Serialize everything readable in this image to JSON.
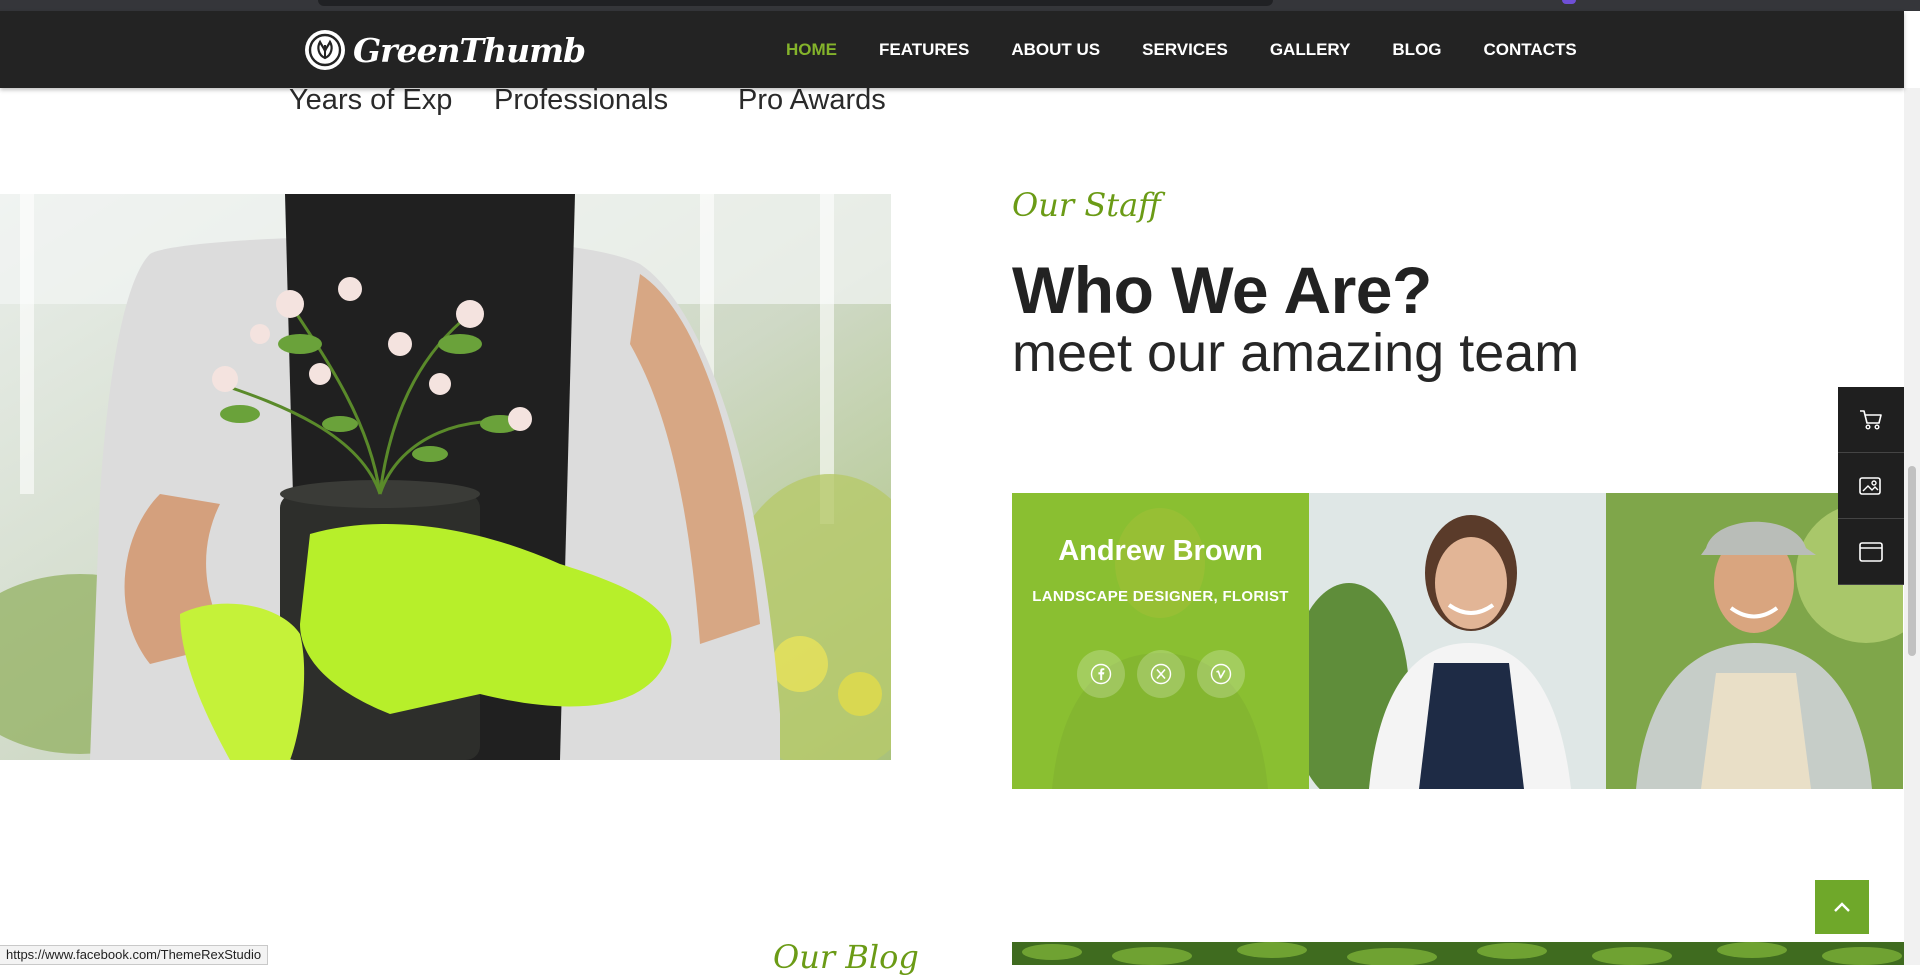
{
  "brand": {
    "name": "GreenThumb",
    "accent": "#84b32b"
  },
  "nav": {
    "items": [
      {
        "label": "HOME",
        "active": true
      },
      {
        "label": "FEATURES",
        "active": false
      },
      {
        "label": "ABOUT US",
        "active": false
      },
      {
        "label": "SERVICES",
        "active": false
      },
      {
        "label": "GALLERY",
        "active": false
      },
      {
        "label": "BLOG",
        "active": false
      },
      {
        "label": "CONTACTS",
        "active": false
      }
    ]
  },
  "stats": {
    "labels": [
      "Years of Exp",
      "Professionals",
      "Pro Awards"
    ]
  },
  "about": {
    "overline": "Our Staff",
    "title": "Who We Are?",
    "subtitle": "meet our amazing team"
  },
  "team": {
    "featured": {
      "name": "Andrew Brown",
      "role": "LANDSCAPE DESIGNER, FLORIST",
      "socials": [
        "facebook-icon",
        "x-icon",
        "vimeo-icon"
      ]
    }
  },
  "side_panel": {
    "icons": [
      "cart-icon",
      "gallery-icon",
      "window-icon"
    ]
  },
  "blog": {
    "overline": "Our Blog"
  },
  "status_bar": {
    "url": "https://www.facebook.com/ThemeRexStudio"
  }
}
